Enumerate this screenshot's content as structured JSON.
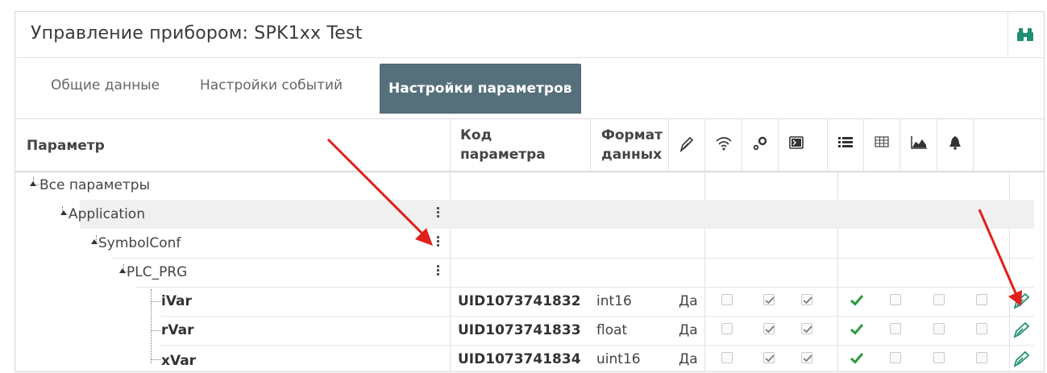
{
  "window": {
    "title": "Управление прибором: SPK1xx Test"
  },
  "tabs": [
    {
      "label": "Общие данные",
      "active": false
    },
    {
      "label": "Настройки событий",
      "active": false
    },
    {
      "label": "Настройки параметров",
      "active": true
    }
  ],
  "columns": {
    "param": "Параметр",
    "code_l1": "Код",
    "code_l2": "параметра",
    "fmt_l1": "Формат",
    "fmt_l2": "данных",
    "icons": [
      "edit-icon",
      "wifi-icon",
      "gears-icon",
      "terminal-icon",
      "list-icon",
      "table-icon",
      "area-chart-icon",
      "bell-icon"
    ]
  },
  "tree": {
    "root": "Все параметры",
    "app": "Application",
    "symbol": "SymbolConf",
    "prg": "PLC_PRG"
  },
  "rows": [
    {
      "name": "iVar",
      "code": "UID1073741832",
      "format": "int16",
      "flag": "Да"
    },
    {
      "name": "rVar",
      "code": "UID1073741833",
      "format": "float",
      "flag": "Да"
    },
    {
      "name": "xVar",
      "code": "UID1073741834",
      "format": "uint16",
      "flag": "Да"
    }
  ],
  "colors": {
    "accent": "#56707b",
    "check_green": "#2a9a3a",
    "binoc": "#1f8f72",
    "arrow": "#e0201b"
  }
}
